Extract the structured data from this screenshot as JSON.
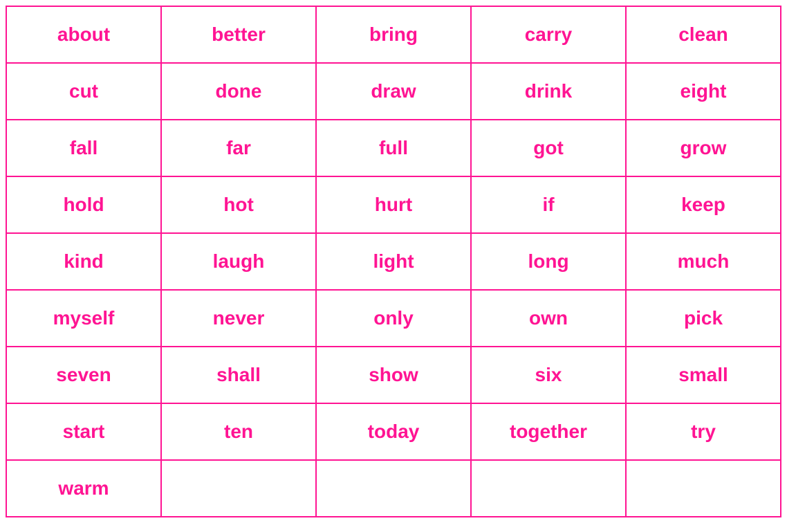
{
  "table": {
    "rows": [
      [
        "about",
        "better",
        "bring",
        "carry",
        "clean"
      ],
      [
        "cut",
        "done",
        "draw",
        "drink",
        "eight"
      ],
      [
        "fall",
        "far",
        "full",
        "got",
        "grow"
      ],
      [
        "hold",
        "hot",
        "hurt",
        "if",
        "keep"
      ],
      [
        "kind",
        "laugh",
        "light",
        "long",
        "much"
      ],
      [
        "myself",
        "never",
        "only",
        "own",
        "pick"
      ],
      [
        "seven",
        "shall",
        "show",
        "six",
        "small"
      ],
      [
        "start",
        "ten",
        "today",
        "together",
        "try"
      ],
      [
        "warm",
        "",
        "",
        "",
        ""
      ]
    ]
  },
  "colors": {
    "text": "#ff1493",
    "border": "#ff1493"
  }
}
